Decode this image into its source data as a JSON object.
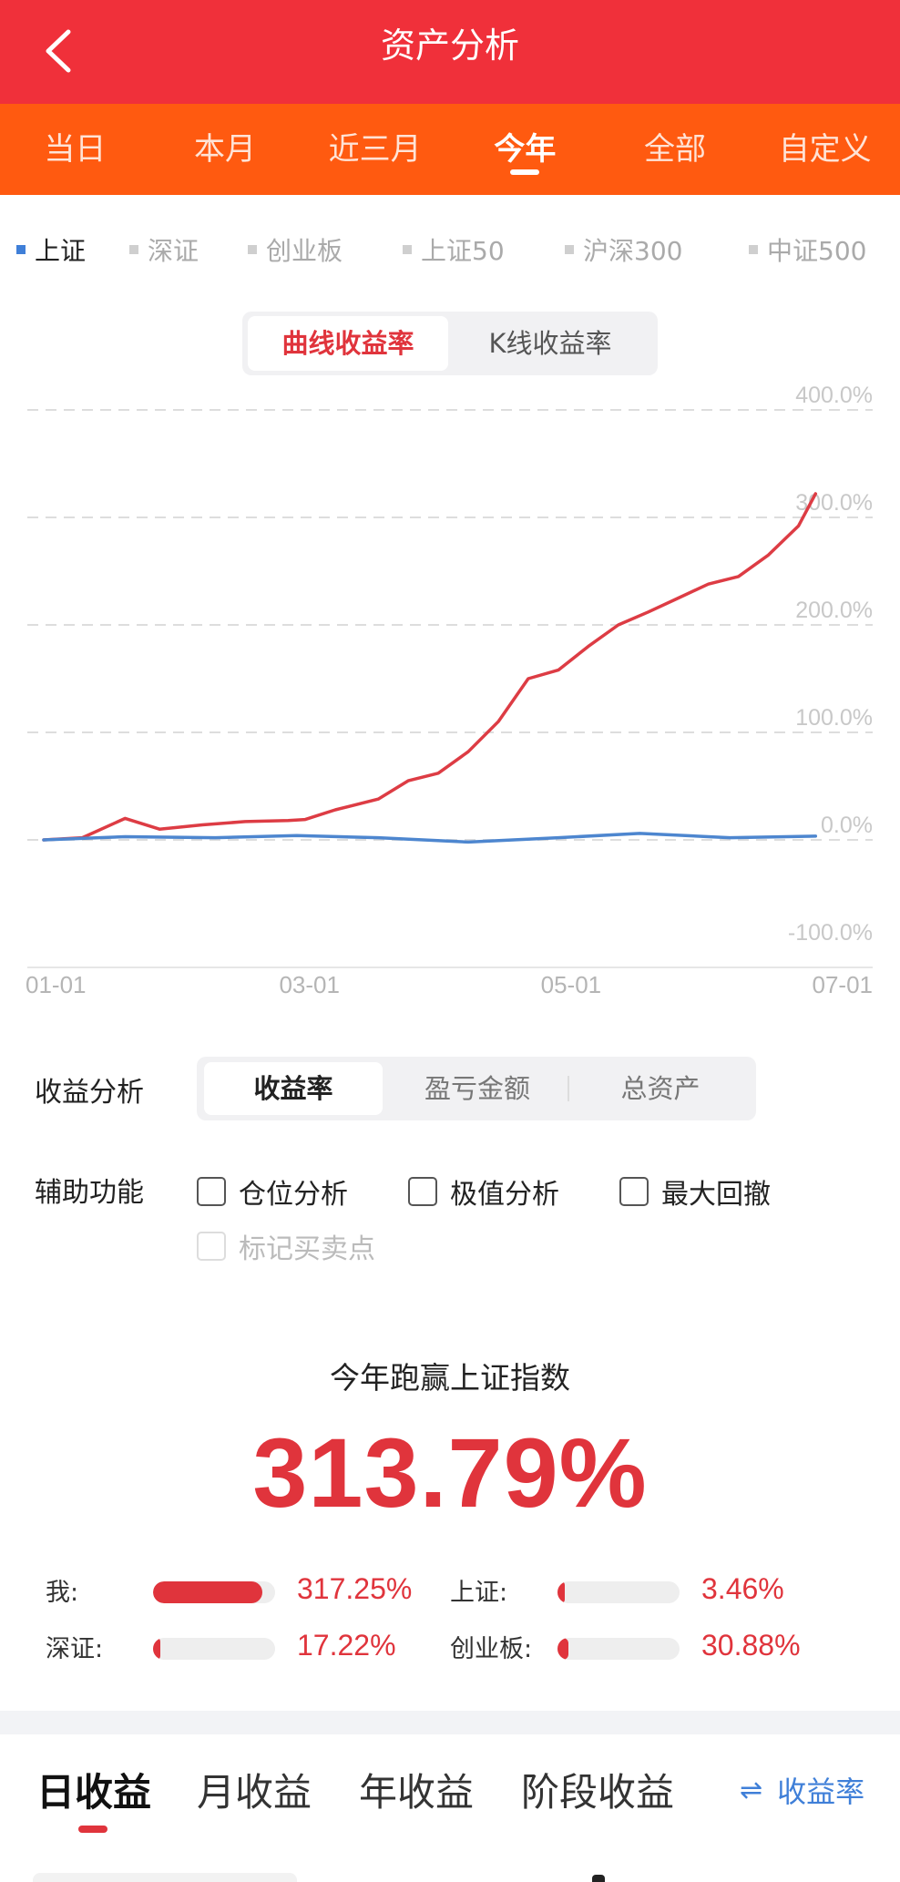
{
  "header": {
    "title": "资产分析"
  },
  "period_tabs": [
    {
      "label": "当日"
    },
    {
      "label": "本月"
    },
    {
      "label": "近三月"
    },
    {
      "label": "今年",
      "active": true
    },
    {
      "label": "全部"
    },
    {
      "label": "自定义"
    }
  ],
  "indices": [
    {
      "label": "上证",
      "active": true
    },
    {
      "label": "深证"
    },
    {
      "label": "创业板"
    },
    {
      "label": "上证50"
    },
    {
      "label": "沪深300"
    },
    {
      "label": "中证500"
    }
  ],
  "chart_mode": {
    "active": "曲线收益率",
    "other": "K线收益率"
  },
  "chart_data": {
    "type": "line",
    "x_ticks": [
      "01-01",
      "03-01",
      "05-01",
      "07-01"
    ],
    "y_ticks": [
      "400.0%",
      "300.0%",
      "200.0%",
      "100.0%",
      "0.0%",
      "-100.0%"
    ],
    "ylim": [
      -100,
      400
    ],
    "grid": true,
    "colors": {
      "mine": "#dd3c44",
      "index": "#4d86cf"
    },
    "series": [
      {
        "key": "mine",
        "x": [
          "01-01",
          "01-10",
          "01-20",
          "01-28",
          "02-07",
          "02-17",
          "02-27",
          "03-03",
          "03-10",
          "03-20",
          "03-27",
          "04-03",
          "04-10",
          "04-17",
          "04-24",
          "05-01",
          "05-08",
          "05-15",
          "05-22",
          "05-29",
          "06-05",
          "06-12",
          "06-19",
          "06-26",
          "06-30"
        ],
        "values": [
          0,
          2,
          20,
          10,
          14,
          17,
          18,
          19,
          28,
          38,
          55,
          62,
          82,
          110,
          150,
          158,
          180,
          200,
          212,
          225,
          238,
          245,
          265,
          292,
          322
        ]
      },
      {
        "key": "index",
        "x": [
          "01-01",
          "01-20",
          "02-10",
          "03-01",
          "03-20",
          "04-10",
          "05-01",
          "05-20",
          "06-10",
          "06-30"
        ],
        "values": [
          0,
          3,
          2,
          4,
          2,
          -2,
          2,
          6,
          2,
          3.5
        ]
      }
    ]
  },
  "analysis": {
    "label": "收益分析",
    "options": [
      {
        "label": "收益率",
        "active": true
      },
      {
        "label": "盈亏金额"
      },
      {
        "label": "总资产"
      }
    ]
  },
  "aux": {
    "label": "辅助功能",
    "options": [
      {
        "label": "仓位分析"
      },
      {
        "label": "极值分析"
      },
      {
        "label": "最大回撤"
      },
      {
        "label": "标记买卖点",
        "disabled": true
      }
    ]
  },
  "summary": {
    "title": "今年跑赢上证指数",
    "value": "313.79%"
  },
  "compare": [
    {
      "label": "我:",
      "value": "317.25%",
      "pct": 317.25
    },
    {
      "label": "上证:",
      "value": "3.46%",
      "pct": 3.46
    },
    {
      "label": "深证:",
      "value": "17.22%",
      "pct": 17.22
    },
    {
      "label": "创业板:",
      "value": "30.88%",
      "pct": 30.88
    }
  ],
  "bottom_tabs": [
    {
      "label": "日收益",
      "active": true
    },
    {
      "label": "月收益"
    },
    {
      "label": "年收益"
    },
    {
      "label": "阶段收益"
    }
  ],
  "switch_label": "收益率"
}
